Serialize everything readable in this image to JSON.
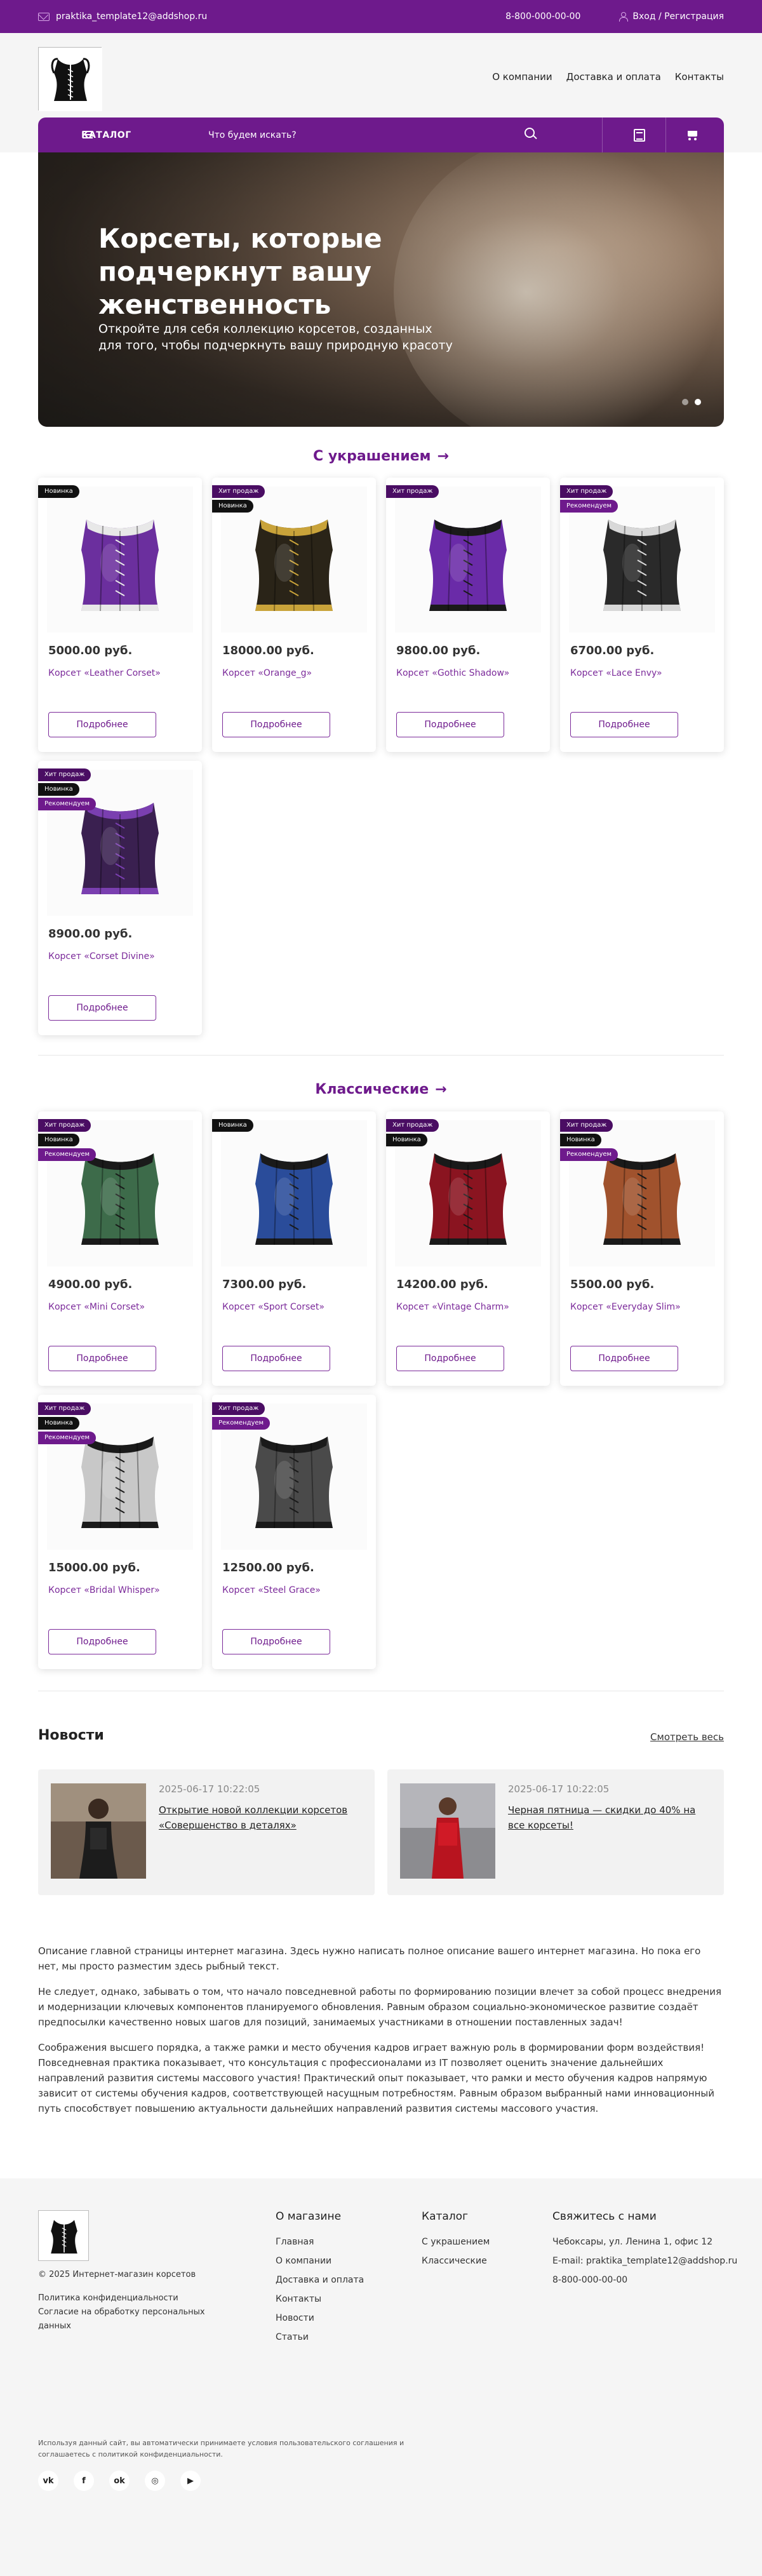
{
  "topbar": {
    "email": "praktika_template12@addshop.ru",
    "phone": "8-800-000-00-00",
    "login": "Вход / Регистрация"
  },
  "nav": [
    "О компании",
    "Доставка и оплата",
    "Контакты"
  ],
  "search": {
    "catalog_label": "КАТАЛОГ",
    "placeholder": "Что будем искать?"
  },
  "hero": {
    "title": "Корсеты, которые подчеркнут вашу женственность",
    "subtitle": "Откройте для себя коллекцию корсетов, созданных для того, чтобы подчеркнуть вашу природную красоту"
  },
  "badges": {
    "hit": "Хит продаж",
    "new": "Новинка",
    "rec": "Рекомендуем"
  },
  "more_label": "Подробнее",
  "sections": [
    {
      "title": "С украшением",
      "products": [
        {
          "price": "5000.00 руб.",
          "name": "Корсет «Leather Corset»",
          "badges": [
            "new"
          ],
          "color": "#6b2f9e",
          "trim": "#e8e8e8"
        },
        {
          "price": "18000.00 руб.",
          "name": "Корсет «Orange_g»",
          "badges": [
            "hit",
            "new"
          ],
          "color": "#2a2418",
          "trim": "#c9a33a"
        },
        {
          "price": "9800.00 руб.",
          "name": "Корсет «Gothic Shadow»",
          "badges": [
            "hit"
          ],
          "color": "#6a2ba8",
          "trim": "#1a1a1a"
        },
        {
          "price": "6700.00 руб.",
          "name": "Корсет «Lace Envy»",
          "badges": [
            "hit",
            "rec"
          ],
          "color": "#2a2a2a",
          "trim": "#d8d8d8"
        },
        {
          "price": "8900.00 руб.",
          "name": "Корсет «Corset Divine»",
          "badges": [
            "hit",
            "new",
            "rec"
          ],
          "color": "#3a2050",
          "trim": "#7a3fb0"
        }
      ]
    },
    {
      "title": "Классические",
      "products": [
        {
          "price": "4900.00 руб.",
          "name": "Корсет «Mini Corset»",
          "badges": [
            "hit",
            "new",
            "rec"
          ],
          "color": "#3d6b4a",
          "trim": "#1a1a1a"
        },
        {
          "price": "7300.00 руб.",
          "name": "Корсет «Sport Corset»",
          "badges": [
            "new"
          ],
          "color": "#2a4c9a",
          "trim": "#1a1a1a"
        },
        {
          "price": "14200.00 руб.",
          "name": "Корсет «Vintage Charm»",
          "badges": [
            "hit",
            "new"
          ],
          "color": "#8a1420",
          "trim": "#1a1a1a"
        },
        {
          "price": "5500.00 руб.",
          "name": "Корсет «Everyday Slim»",
          "badges": [
            "hit",
            "new",
            "rec"
          ],
          "color": "#a0522d",
          "trim": "#1a1a1a"
        },
        {
          "price": "15000.00 руб.",
          "name": "Корсет «Bridal Whisper»",
          "badges": [
            "hit",
            "new",
            "rec"
          ],
          "color": "#c8c8c8",
          "trim": "#1a1a1a"
        },
        {
          "price": "12500.00 руб.",
          "name": "Корсет «Steel Grace»",
          "badges": [
            "hit",
            "rec"
          ],
          "color": "#4a4a4a",
          "trim": "#1a1a1a"
        }
      ]
    }
  ],
  "news": {
    "title": "Новости",
    "see_all": "Смотреть весь",
    "items": [
      {
        "date": "2025-06-17 10:22:05",
        "text": "Открытие новой коллекции корсетов «Совершенство в деталях»"
      },
      {
        "date": "2025-06-17 10:22:05",
        "text": "Черная пятница — скидки до 40% на все корсеты!"
      }
    ]
  },
  "about": [
    "Описание главной страницы интернет магазина. Здесь нужно написать полное описание вашего интернет магазина. Но пока его нет, мы просто разместим здесь рыбный текст.",
    "Не следует, однако, забывать о том, что начало повседневной работы по формированию позиции влечет за собой процесс внедрения и модернизации ключевых компонентов планируемого обновления. Равным образом социально-экономическое развитие создаёт предпосылки качественно новых шагов для позиций, занимаемых участниками в отношении поставленных задач!",
    "Соображения высшего порядка, а также рамки и место обучения кадров играет важную роль в формировании форм воздействия! Повседневная практика показывает, что консультация с профессионалами из IT позволяет оценить значение дальнейших направлений развития системы массового участия! Практический опыт показывает, что рамки и место обучения кадров напрямую зависит от системы обучения кадров, соответствующей насущным потребностям. Равным образом выбранный нами инновационный путь способствует повышению актуальности дальнейших направлений развития системы массового участия."
  ],
  "footer": {
    "copyright": "© 2025 Интернет-магазин корсетов",
    "links": [
      "Политика конфиденциальности",
      "Согласие на обработку персональных данных"
    ],
    "col1": {
      "title": "О магазине",
      "items": [
        "Главная",
        "О компании",
        "Доставка и оплата",
        "Контакты",
        "Новости",
        "Статьи"
      ]
    },
    "col2": {
      "title": "Каталог",
      "items": [
        "С украшением",
        "Классические"
      ]
    },
    "col3": {
      "title": "Свяжитесь с нами",
      "items": [
        "Чебоксары, ул. Ленина 1, офис 12",
        "E-mail: praktika_template12@addshop.ru",
        "8-800-000-00-00"
      ]
    },
    "note": "Используя данный сайт, вы автоматически принимаете условия пользовательского соглашения и соглашаетесь с политикой конфиденциальности.",
    "social": [
      "vk-icon",
      "facebook-icon",
      "ok-icon",
      "instagram-icon",
      "youtube-icon"
    ]
  },
  "colors": {
    "brand": "#6e1a8c",
    "badge_hit": "#4a0d63",
    "badge_new": "#111111",
    "badge_rec": "#6e1a8c"
  }
}
